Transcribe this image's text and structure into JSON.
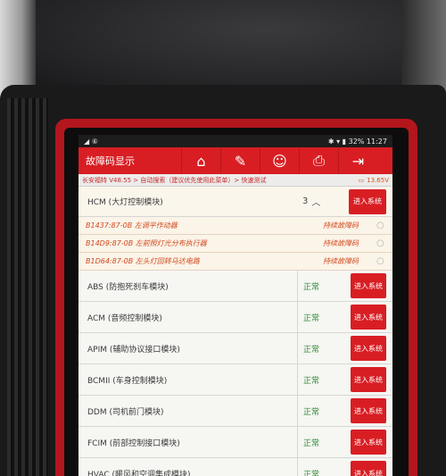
{
  "statusbar": {
    "left": "◢ ⑥",
    "right": "✱ ▾ ▮ 32% 11:27"
  },
  "header": {
    "title": "故障码显示",
    "buttons": [
      "⌂",
      "✎",
      "☺",
      "⎙",
      "⇥"
    ]
  },
  "breadcrumb": {
    "path": "长安福特 V48.55 > 自动搜索（建议优先使用此菜单）> 快速测试",
    "battery": "13.65V"
  },
  "hcm": {
    "name": "HCM (大灯控制模块)",
    "count": "3",
    "toggle": "︿",
    "enter": "进入系统"
  },
  "dtcs": [
    {
      "code": "B1437:87-0B 左调平作动器",
      "status": "持续故障码",
      "search": "○"
    },
    {
      "code": "B14D9:87-0B 左前照灯光分布执行器",
      "status": "持续故障码",
      "search": "○"
    },
    {
      "code": "B1D64:87-0B 左头灯回转马达电路",
      "status": "持续故障码",
      "search": "○"
    }
  ],
  "modules": [
    {
      "name": "ABS (防抱死刹车模块)",
      "status": "正常",
      "enter": "进入系统"
    },
    {
      "name": "ACM (音频控制模块)",
      "status": "正常",
      "enter": "进入系统"
    },
    {
      "name": "APIM (辅助协议接口模块)",
      "status": "正常",
      "enter": "进入系统"
    },
    {
      "name": "BCMII (车身控制模块)",
      "status": "正常",
      "enter": "进入系统"
    },
    {
      "name": "DDM (司机前门模块)",
      "status": "正常",
      "enter": "进入系统"
    },
    {
      "name": "FCIM (前部控制接口模块)",
      "status": "正常",
      "enter": "进入系统"
    },
    {
      "name": "HVAC (暖风和空调集成模块)",
      "status": "正常",
      "enter": "进入系统"
    }
  ],
  "colors": {
    "accent": "#d81e23",
    "dtc": "#d2471d",
    "ok": "#2f8a36"
  }
}
